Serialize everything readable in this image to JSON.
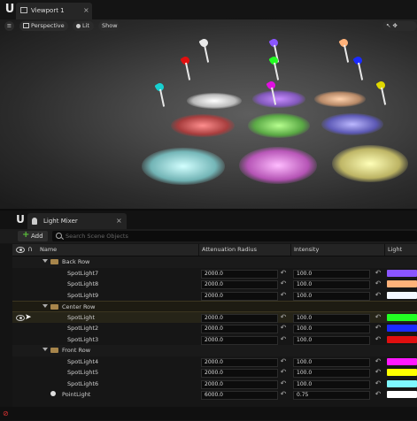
{
  "viewport_window": {
    "tab_label": "Viewport 1",
    "toolbar": {
      "perspective_label": "Perspective",
      "lit_label": "Lit",
      "show_label": "Show"
    }
  },
  "light_mixer": {
    "tab_label": "Light Mixer",
    "add_label": "Add",
    "search_placeholder": "Search Scene Objects",
    "columns": {
      "name": "Name",
      "attenuation": "Attenuation Radius",
      "intensity": "Intensity",
      "light_color": "Light Color"
    },
    "groups": [
      {
        "label": "Back Row"
      },
      {
        "label": "Center Row"
      },
      {
        "label": "Front Row"
      }
    ],
    "rows": [
      {
        "name": "SpotLight7",
        "attenuation": "2000.0",
        "intensity": "100.0",
        "color": "#8a55ff"
      },
      {
        "name": "SpotLight8",
        "attenuation": "2000.0",
        "intensity": "100.0",
        "color": "#ffb27a"
      },
      {
        "name": "SpotLight9",
        "attenuation": "2000.0",
        "intensity": "100.0",
        "color": "#f4f8ff"
      },
      {
        "name": "SpotLight",
        "attenuation": "2000.0",
        "intensity": "100.0",
        "color": "#22ff22"
      },
      {
        "name": "SpotLight2",
        "attenuation": "2000.0",
        "intensity": "100.0",
        "color": "#1b2bff"
      },
      {
        "name": "SpotLight3",
        "attenuation": "2000.0",
        "intensity": "100.0",
        "color": "#e00f0f"
      },
      {
        "name": "SpotLight4",
        "attenuation": "2000.0",
        "intensity": "100.0",
        "color": "#ff18ff"
      },
      {
        "name": "SpotLight5",
        "attenuation": "2000.0",
        "intensity": "100.0",
        "color": "#ffff00"
      },
      {
        "name": "SpotLight6",
        "attenuation": "2000.0",
        "intensity": "100.0",
        "color": "#7ff7ff"
      },
      {
        "name": "PointLight",
        "attenuation": "6000.0",
        "intensity": "0.75",
        "color": "#ffffff"
      }
    ]
  },
  "colors": {
    "accent_yellow": "#c9a227",
    "folder": "#a7854b"
  }
}
